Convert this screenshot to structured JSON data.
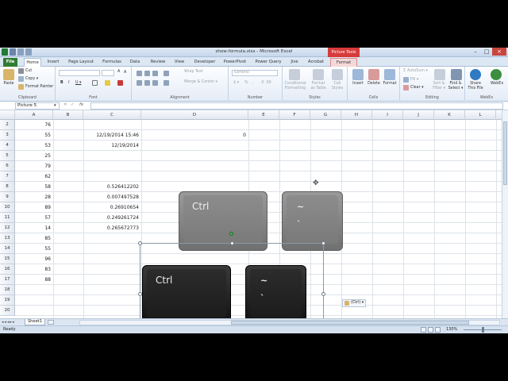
{
  "window": {
    "title": "show-formula.xlsx - Microsoft Excel",
    "context_tools": "Picture Tools"
  },
  "tabs": [
    "File",
    "Home",
    "Insert",
    "Page Layout",
    "Formulas",
    "Data",
    "Review",
    "View",
    "Developer",
    "PowerPivot",
    "Power Query",
    "Jive",
    "Acrobat",
    "Format"
  ],
  "ribbon": {
    "clipboard": {
      "paste": "Paste",
      "cut": "Cut",
      "copy": "Copy ▾",
      "format_painter": "Format Painter",
      "label": "Clipboard"
    },
    "font": {
      "bold": "B",
      "italic": "I",
      "underline": "U ▾",
      "label": "Font"
    },
    "alignment": {
      "wrap": "Wrap Text",
      "merge": "Merge & Center ▾",
      "label": "Alignment"
    },
    "number": {
      "format": "General",
      "label": "Number"
    },
    "styles": {
      "conditional": "Conditional Formatting",
      "table": "Format as Table",
      "cell": "Cell Styles",
      "label": "Styles"
    },
    "cells": {
      "insert": "Insert",
      "delete": "Delete",
      "format": "Format",
      "label": "Cells"
    },
    "editing": {
      "autosum": "AutoSum ▾",
      "fill": "Fill ▾",
      "clear": "Clear ▾",
      "sort": "Sort & Filter ▾",
      "find": "Find & Select ▾",
      "label": "Editing"
    },
    "webex": {
      "share": "Share This File",
      "webex": "WebEx",
      "label": "WebEx"
    }
  },
  "formula_bar": {
    "name_box": "Picture 5",
    "fx": "fx",
    "content": ""
  },
  "columns": [
    "A",
    "B",
    "C",
    "D",
    "E",
    "F",
    "G",
    "H",
    "I",
    "J",
    "K",
    "L"
  ],
  "rows": [
    "2",
    "3",
    "4",
    "5",
    "6",
    "7",
    "8",
    "9",
    "10",
    "11",
    "12",
    "13",
    "14",
    "15",
    "16",
    "17",
    "18",
    "19",
    "20"
  ],
  "cells": {
    "colA": [
      "76",
      "55",
      "53",
      "25",
      "79",
      "62",
      "58",
      "28",
      "89",
      "57",
      "14",
      "85",
      "55",
      "96",
      "83",
      "88"
    ],
    "c3": "12/19/2014 15:46",
    "c4": "12/19/2014",
    "e3": "0",
    "colC": [
      "0.526412202",
      "0.007497528",
      "0.26910654",
      "0.249261724",
      "0.265672773"
    ]
  },
  "keys": {
    "ctrl": "Ctrl",
    "tilde": "~",
    "backtick": "`"
  },
  "paste_options": "(Ctrl) ▾",
  "sheet": {
    "tab": "Sheet1"
  },
  "status": {
    "ready": "Ready",
    "zoom": "130%"
  }
}
